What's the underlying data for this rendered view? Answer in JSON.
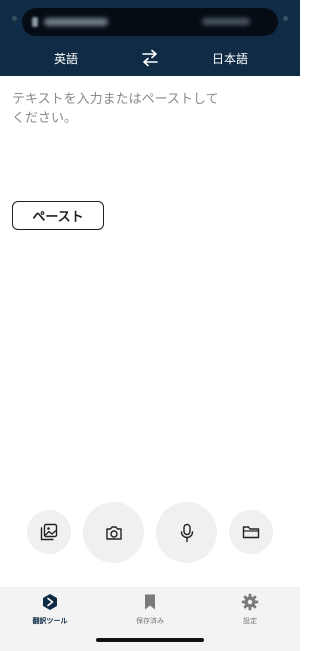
{
  "header": {
    "source_language": "英語",
    "target_language": "日本語",
    "swap_icon": "swap-arrows-icon"
  },
  "input": {
    "placeholder": "テキストを入力またはペーストしてください。",
    "paste_label": "ペースト"
  },
  "actions": [
    {
      "icon": "image-icon"
    },
    {
      "icon": "camera-icon"
    },
    {
      "icon": "microphone-icon"
    },
    {
      "icon": "folder-icon"
    }
  ],
  "tabs": [
    {
      "label": "翻訳ツール",
      "icon": "translate-logo-icon",
      "active": true
    },
    {
      "label": "保存済み",
      "icon": "bookmark-icon",
      "active": false
    },
    {
      "label": "設定",
      "icon": "gear-icon",
      "active": false
    }
  ],
  "colors": {
    "header_bg": "#0f2b46",
    "accent": "#0f2b46",
    "inactive": "#777777"
  }
}
